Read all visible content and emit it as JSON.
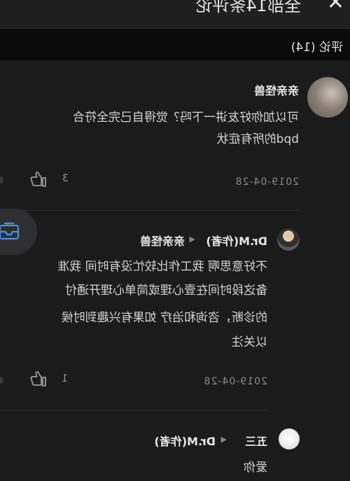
{
  "header": {
    "title": "全部14条评论",
    "close_icon": "close-icon"
  },
  "count_bar": {
    "label": "评论 (14)"
  },
  "comments": [
    {
      "author": "亲亲怪兽",
      "text_lines": [
        "可以加你好友讲一下吗？觉得自己完全符合",
        "bpd的所有症状"
      ],
      "date": "2019-04-28",
      "likes": "3"
    },
    {
      "author": "Dr.M(作者)",
      "reply_to": "亲亲怪兽",
      "text_lines": [
        "不好意思啊 我工作比较忙没有时间 我准",
        "备这段时间在壹心理或简单心理开通付",
        "的诊断，咨询和治疗 如果有兴趣到时候",
        "以关注"
      ],
      "date": "2019-04-28",
      "likes": "1"
    },
    {
      "author": "五三",
      "reply_to": "Dr.M(作者)",
      "text_lines": [
        "爱你"
      ]
    }
  ],
  "float_button": {
    "icon": "message-inbox-icon",
    "accent": "#4a90e2"
  },
  "colors": {
    "background": "#1b1b1b",
    "count_bar": "#0b0b0b",
    "text": "#e6e6e6",
    "muted": "#8a8a8a"
  }
}
